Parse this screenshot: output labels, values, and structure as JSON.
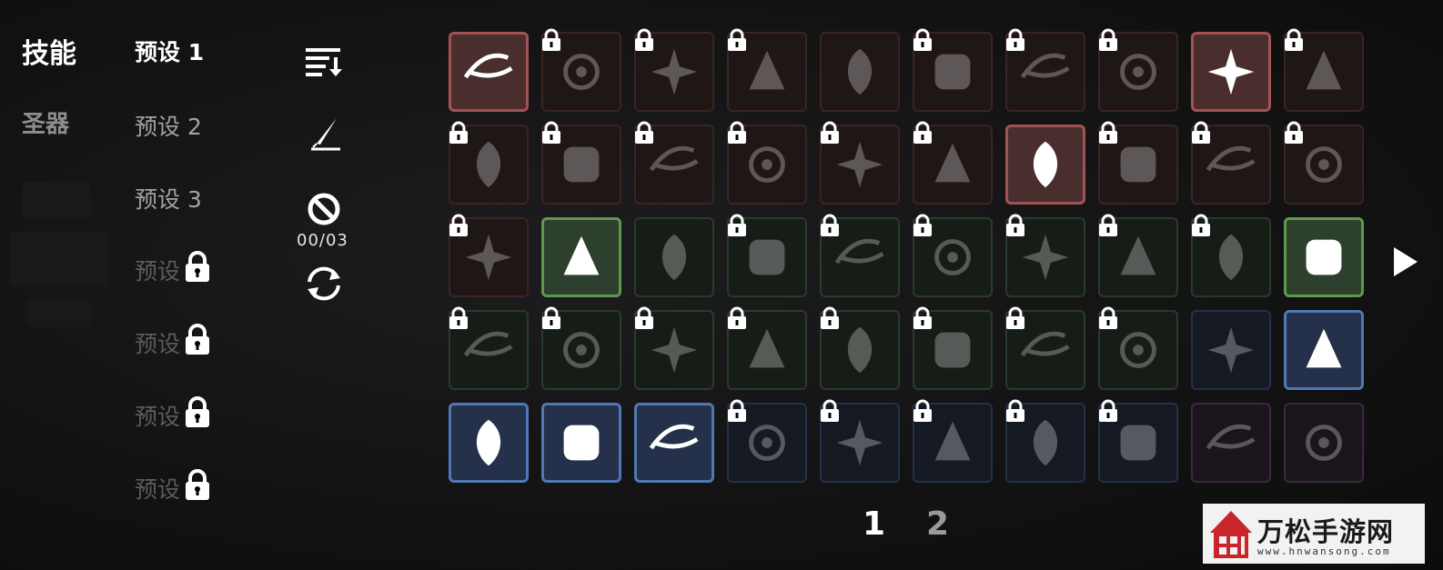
{
  "tabs": [
    {
      "label": "技能",
      "active": true
    },
    {
      "label": "圣器",
      "active": false
    }
  ],
  "presets": [
    {
      "label": "预设 1",
      "state": "selected"
    },
    {
      "label": "预设 2",
      "state": "unlocked"
    },
    {
      "label": "预设 3",
      "state": "unlocked"
    },
    {
      "label": "预设",
      "state": "locked"
    },
    {
      "label": "预设",
      "state": "locked"
    },
    {
      "label": "预设",
      "state": "locked"
    },
    {
      "label": "预设",
      "state": "locked"
    }
  ],
  "tools": {
    "sort_icon": "sort-icon",
    "quill_icon": "quill-icon",
    "clear_icon": "no-entry-icon",
    "counter": "00/03",
    "refresh_icon": "refresh-icon"
  },
  "colors": {
    "red": "#a25252",
    "green": "#5f9a4c",
    "blue": "#4f78b4",
    "purple": "#3a2a3d"
  },
  "skills": [
    [
      {
        "color": "red",
        "equipped": true,
        "locked": false,
        "icon": "slash-icon"
      },
      {
        "color": "red",
        "equipped": false,
        "locked": true,
        "icon": "blade-swirl-icon"
      },
      {
        "color": "red",
        "equipped": false,
        "locked": true,
        "icon": "rose-icon"
      },
      {
        "color": "red",
        "equipped": false,
        "locked": true,
        "icon": "starburst-icon"
      },
      {
        "color": "red",
        "equipped": false,
        "locked": false,
        "icon": "arrows-icon"
      },
      {
        "color": "red",
        "equipped": false,
        "locked": true,
        "icon": "snow-orb-icon"
      },
      {
        "color": "red",
        "equipped": false,
        "locked": true,
        "icon": "fire-orb-icon"
      },
      {
        "color": "red",
        "equipped": false,
        "locked": true,
        "icon": "dark-cloud-icon"
      },
      {
        "color": "red",
        "equipped": true,
        "locked": false,
        "icon": "triple-spear-icon"
      },
      {
        "color": "red",
        "equipped": false,
        "locked": true,
        "icon": "skull-bird-icon"
      }
    ],
    [
      {
        "color": "red",
        "equipped": false,
        "locked": true,
        "icon": "crescent-icon"
      },
      {
        "color": "red",
        "equipped": false,
        "locked": true,
        "icon": "feathers-icon"
      },
      {
        "color": "red",
        "equipped": false,
        "locked": true,
        "icon": "leaf-icon"
      },
      {
        "color": "red",
        "equipped": false,
        "locked": true,
        "icon": "crosshair-icon"
      },
      {
        "color": "red",
        "equipped": false,
        "locked": true,
        "icon": "frost-sword-icon"
      },
      {
        "color": "red",
        "equipped": false,
        "locked": true,
        "icon": "vortex-icon"
      },
      {
        "color": "red",
        "equipped": true,
        "locked": false,
        "icon": "target-orb-icon"
      },
      {
        "color": "red",
        "equipped": false,
        "locked": true,
        "icon": "thorn-icon"
      },
      {
        "color": "red",
        "equipped": false,
        "locked": true,
        "icon": "splash-icon"
      },
      {
        "color": "red",
        "equipped": false,
        "locked": true,
        "icon": "fist-icon"
      }
    ],
    [
      {
        "color": "red",
        "equipped": false,
        "locked": true,
        "icon": "ring-icon"
      },
      {
        "color": "green",
        "equipped": true,
        "locked": false,
        "icon": "ground-spike-icon"
      },
      {
        "color": "green",
        "equipped": false,
        "locked": false,
        "icon": "chain-icon"
      },
      {
        "color": "green",
        "equipped": false,
        "locked": true,
        "icon": "lightning-icon"
      },
      {
        "color": "green",
        "equipped": false,
        "locked": true,
        "icon": "cannon-icon"
      },
      {
        "color": "green",
        "equipped": false,
        "locked": true,
        "icon": "flame-ring-icon"
      },
      {
        "color": "green",
        "equipped": false,
        "locked": true,
        "icon": "skull-burst-icon"
      },
      {
        "color": "green",
        "equipped": false,
        "locked": true,
        "icon": "biohazard-icon"
      },
      {
        "color": "green",
        "equipped": false,
        "locked": true,
        "icon": "laser-icon"
      },
      {
        "color": "green",
        "equipped": true,
        "locked": false,
        "icon": "flame-potion-icon"
      }
    ],
    [
      {
        "color": "green",
        "equipped": false,
        "locked": true,
        "icon": "claw-ring-icon"
      },
      {
        "color": "green",
        "equipped": false,
        "locked": true,
        "icon": "daggers-icon"
      },
      {
        "color": "green",
        "equipped": false,
        "locked": true,
        "icon": "wings-icon"
      },
      {
        "color": "green",
        "equipped": false,
        "locked": true,
        "icon": "spider-icon"
      },
      {
        "color": "green",
        "equipped": false,
        "locked": true,
        "icon": "particles-icon"
      },
      {
        "color": "green",
        "equipped": false,
        "locked": true,
        "icon": "shards-icon"
      },
      {
        "color": "green",
        "equipped": false,
        "locked": true,
        "icon": "shuriken-icon"
      },
      {
        "color": "green",
        "equipped": false,
        "locked": true,
        "icon": "gear-ring-icon"
      },
      {
        "color": "blue",
        "equipped": false,
        "locked": false,
        "icon": "shield-orb-icon"
      },
      {
        "color": "blue",
        "equipped": true,
        "locked": false,
        "icon": "ghost-flame-icon"
      }
    ],
    [
      {
        "color": "blue",
        "equipped": true,
        "locked": false,
        "icon": "hourglass-up-icon"
      },
      {
        "color": "blue",
        "equipped": true,
        "locked": false,
        "icon": "boot-up-icon"
      },
      {
        "color": "blue",
        "equipped": true,
        "locked": false,
        "icon": "sword-up-icon"
      },
      {
        "color": "blue",
        "equipped": false,
        "locked": true,
        "icon": "eclipse-icon"
      },
      {
        "color": "blue",
        "equipped": false,
        "locked": true,
        "icon": "shield-bolt-icon"
      },
      {
        "color": "blue",
        "equipped": false,
        "locked": true,
        "icon": "axe-up-icon"
      },
      {
        "color": "blue",
        "equipped": false,
        "locked": true,
        "icon": "spiral-orb-icon"
      },
      {
        "color": "blue",
        "equipped": false,
        "locked": true,
        "icon": "wave-icon"
      },
      {
        "color": "purple",
        "equipped": false,
        "locked": false,
        "icon": "bubbles-icon"
      },
      {
        "color": "purple",
        "equipped": false,
        "locked": false,
        "icon": "demon-icon"
      }
    ]
  ],
  "pagination": {
    "pages": [
      "1",
      "2"
    ],
    "current": "1"
  },
  "next_icon": "play-arrow-icon",
  "watermark": {
    "title": "万松手游网",
    "subtitle": "www.hnwansong.com"
  }
}
